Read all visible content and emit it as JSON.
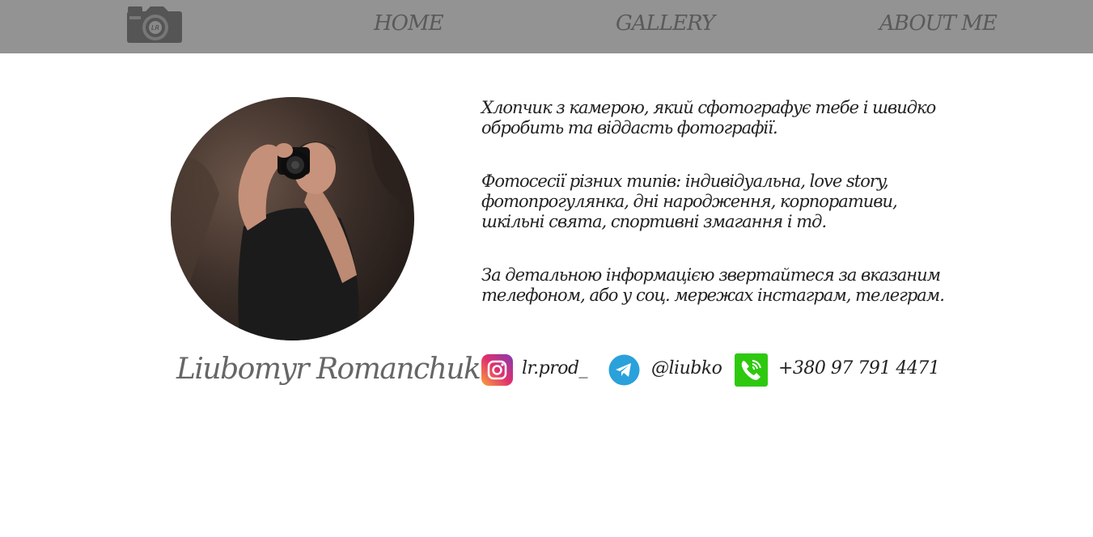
{
  "nav": {
    "home": "HOME",
    "gallery": "GALLERY",
    "about": "ABOUT ME",
    "logo_icon": "camera-icon"
  },
  "colors": {
    "topbar": "#939393",
    "nav_text": "#5a5a5a",
    "instagram_gradient": [
      "#f9a23c",
      "#e1306c",
      "#833ab4"
    ],
    "telegram": "#2aa1da",
    "phone": "#2ec90f"
  },
  "profile": {
    "name": "Liubomyr Romanchuk"
  },
  "about": {
    "paragraph_1": "Хлопчик з камерою, який сфотографує тебе і швидко обробить та віддасть фотографії.",
    "paragraph_2": "Фотосесії різних типів: індивідуальна, love story, фотопрогулянка, дні народження, корпоративи, шкільні свята, спортивні змагання і тд.",
    "paragraph_3": "За детальною інформацією звертайтеся за вказаним телефоном, або у соц. мережах інстаграм, телеграм."
  },
  "contacts": {
    "instagram": "lr.prod_",
    "telegram": "@liubko",
    "phone": "+380 97 791 4471"
  }
}
